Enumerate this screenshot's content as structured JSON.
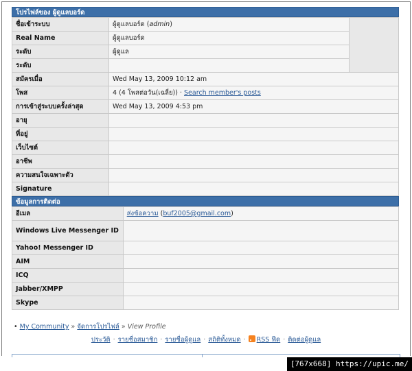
{
  "profile": {
    "header": "โปรไฟล์ของ ผู้ดูแลบอร์ด",
    "rows": [
      {
        "label": "ชื่อเข้าระบบ",
        "value": "ผู้ดูแลบอร์ด",
        "extra": "admin"
      },
      {
        "label": "Real Name",
        "value": "ผู้ดูแลบอร์ด"
      },
      {
        "label": "ระดับ",
        "value": "ผู้ดูแล"
      },
      {
        "label": "ระดับ",
        "value": ""
      },
      {
        "label": "สมัครเมื่อ",
        "value": "Wed May 13, 2009 10:12 am"
      },
      {
        "label": "โพส",
        "value": "4 (4 โพสต่อวัน(เฉลี่ย))",
        "link": "Search member's posts"
      },
      {
        "label": "การเข้าสู่ระบบครั้งล่าสุด",
        "value": "Wed May 13, 2009 4:53 pm"
      },
      {
        "label": "อายุ",
        "value": ""
      },
      {
        "label": "ที่อยู่",
        "value": ""
      },
      {
        "label": "เว็บไซต์",
        "value": ""
      },
      {
        "label": "อาชีพ",
        "value": ""
      },
      {
        "label": "ความสนใจเฉพาะตัว",
        "value": ""
      },
      {
        "label": "Signature",
        "value": ""
      }
    ]
  },
  "contact": {
    "header": "ข้อมูลการติดต่อ",
    "email_label": "อีเมล",
    "email_send": "ส่งข้อความ",
    "email_address": "buf2005@gmail.com",
    "rows": [
      {
        "label": "Windows Live Messenger ID"
      },
      {
        "label": "Yahoo! Messenger ID"
      },
      {
        "label": "AIM"
      },
      {
        "label": "ICQ"
      },
      {
        "label": "Jabber/XMPP"
      },
      {
        "label": "Skype"
      }
    ]
  },
  "breadcrumb": {
    "bullet": "•",
    "home": "My Community",
    "sep": "»",
    "manage": "จัดการโปรไฟล์",
    "current": "View Profile"
  },
  "footer": {
    "links": [
      "ประวัติ",
      "รายชื่อสมาชิก",
      "รายชื่อผู้ดูแล",
      "สถิติทั้งหมด",
      "RSS ฟีด",
      "ติดต่อผู้ดูแล"
    ],
    "dot": "·"
  },
  "watermark": "[767x668] https://upic.me/"
}
